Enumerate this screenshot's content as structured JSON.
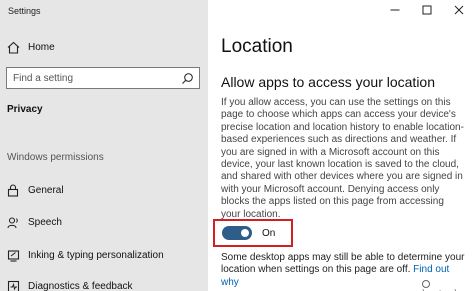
{
  "window": {
    "title": "Settings"
  },
  "sidebar": {
    "home_label": "Home",
    "search_placeholder": "Find a setting",
    "section_title": "Privacy",
    "group_title": "Windows permissions",
    "items": [
      {
        "label": "General",
        "icon": "lock-icon"
      },
      {
        "label": "Speech",
        "icon": "speech-icon"
      },
      {
        "label": "Inking & typing personalization",
        "icon": "inking-icon"
      },
      {
        "label": "Diagnostics & feedback",
        "icon": "diagnostics-icon"
      }
    ]
  },
  "main": {
    "title": "Location",
    "subtitle": "Allow apps to access your location",
    "description": "If you allow access, you can use the settings on this page to choose which apps can access your device's precise location and location history to enable location-based experiences such as directions and weather. If you are signed in with a Microsoft account on this device, your last known location is saved to the cloud, and shared with other devices where you are signed in with your Microsoft account. Denying access only blocks the apps listed on this page from accessing your location.",
    "toggle": {
      "state_label": "On",
      "on": true,
      "accent": "#2f5d8a"
    },
    "note_text": "Some desktop apps may still be able to determine your location when settings on this page are off. ",
    "note_link": "Find out why"
  },
  "watermark": "howtoedge",
  "colors": {
    "sidebar_bg": "#e6e6e6",
    "accent": "#2f5d8a",
    "highlight_border": "#d02020",
    "link": "#0060b0"
  }
}
